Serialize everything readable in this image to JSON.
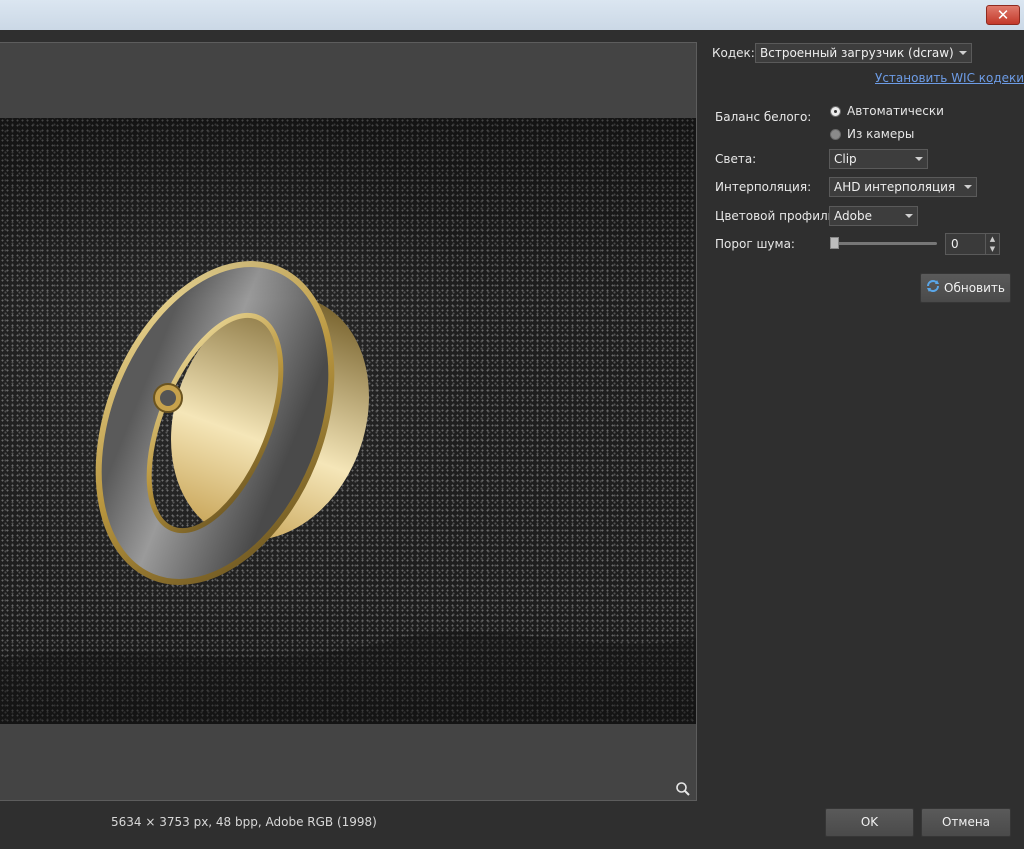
{
  "window": {
    "close_symbol": "✕"
  },
  "preview": {
    "info": "5634 × 3753 px, 48 bpp, Adobe RGB (1998)",
    "zoom_icon": "magnifier-icon"
  },
  "panel": {
    "codec_label": "Кодек:",
    "codec_value": "Встроенный загрузчик (dcraw)",
    "install_link": "Установить WIC кодеки",
    "white_balance_label": "Баланс белого:",
    "white_balance_options": [
      "Автоматически",
      "Из камеры"
    ],
    "white_balance_selected": 0,
    "highlights_label": "Света:",
    "highlights_value": "Clip",
    "interpolation_label": "Интерполяция:",
    "interpolation_value": "AHD интерполяция",
    "color_profile_label": "Цветовой профиль:",
    "color_profile_value": "Adobe",
    "noise_label": "Порог шума:",
    "noise_value": "0",
    "noise_slider_fraction": 0,
    "refresh_label": "Обновить"
  },
  "footer": {
    "ok_label": "OK",
    "cancel_label": "Отмена"
  },
  "colors": {
    "background": "#2f2f2f",
    "link": "#6d9ce6",
    "close_button": "#c3392a"
  }
}
